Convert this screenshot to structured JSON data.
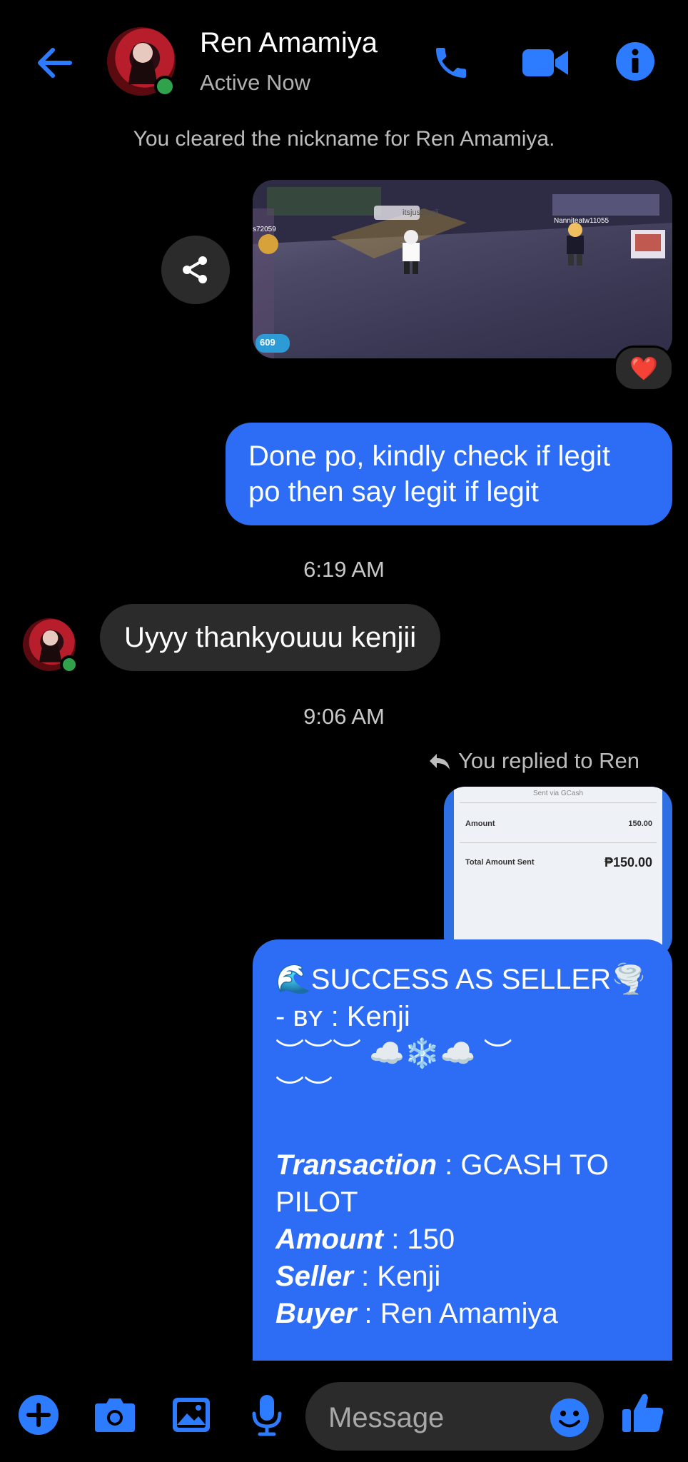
{
  "header": {
    "contact_name": "Ren Amamiya",
    "status": "Active Now",
    "icons": [
      "back-arrow-icon",
      "phone-icon",
      "video-camera-icon",
      "info-icon"
    ]
  },
  "conversation": {
    "system_notice": "You cleared the nickname for Ren Amamiya.",
    "image_message": {
      "game_labels": [
        "itsjustkenji",
        "Nanniteatw11055",
        "s72059",
        "609"
      ],
      "reaction": "❤️"
    },
    "outgoing_1": "Done po, kindly check if legit po then say legit if legit",
    "time_1": "6:19 AM",
    "incoming_1": "Uyyy thankyouuu kenjii",
    "time_2": "9:06 AM",
    "replied_label": "You replied to Ren",
    "reply_preview": {
      "header": "Sent via GCash",
      "amount_label": "Amount",
      "amount_value": "150.00",
      "total_label": "Total Amount Sent",
      "total_value": "₱150.00"
    },
    "success_message": {
      "title": "🌊SUCCESS AS SELLER🌪️",
      "byline": "- ʙʏ : Kenji",
      "deco_line1": "︶︶︶ ☁️❄️☁️ ︶",
      "deco_line2": "︶︶",
      "transaction_label": "Transaction",
      "transaction_value": " : GCASH TO PILOT",
      "amount_label": "Amount",
      "amount_value": " : 150",
      "seller_label": "Seller",
      "seller_value": " : Kenji",
      "buyer_label": "Buyer",
      "buyer_value": " : Ren Amamiya"
    }
  },
  "composer": {
    "placeholder": "Message",
    "icons": [
      "plus-icon",
      "camera-icon",
      "gallery-icon",
      "microphone-icon",
      "emoji-icon",
      "thumbs-up-icon"
    ]
  },
  "colors": {
    "accent": "#2d7cff",
    "bubble_out": "#2d6df6",
    "bubble_in": "#2b2b2b",
    "online": "#31a24c"
  }
}
